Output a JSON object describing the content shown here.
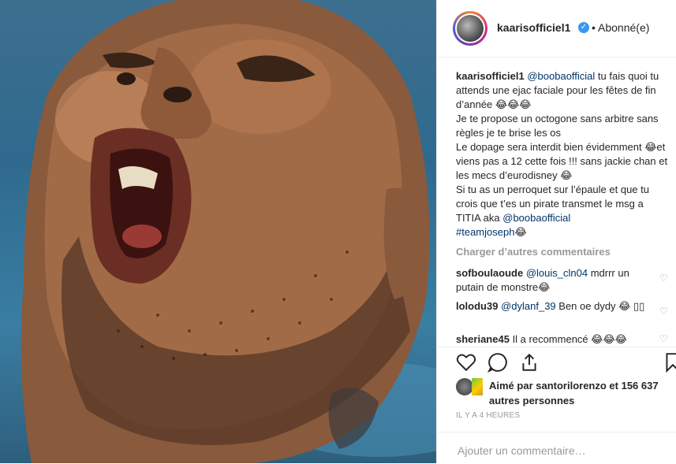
{
  "header": {
    "username": "kaarisofficiel1",
    "verified_glyph": "✓",
    "follow_status": "• Abonné(e)"
  },
  "caption": {
    "username": "kaarisofficiel1",
    "mention1": "@boobaofficial",
    "line1": " tu fais quoi tu attends une ejac faciale pour les fêtes de fin d’année 😂😂😂",
    "line2": "Je te propose un octogone sans arbitre sans règles je te brise les os",
    "line3": "Le dopage sera interdit bien évidemment 😂et viens pas a 12 cette fois !!! sans jackie chan et les mecs d’eurodisney 😂",
    "line4": "Si tu as un perroquet sur l’épaule et que tu crois que t’es un pirate transmet le msg a TITIA aka ",
    "mention2": "@boobaofficial",
    "hashtag": "#teamjoseph",
    "hashtag_emoji": "😂"
  },
  "load_more_label": "Charger d’autres commentaires",
  "comments": [
    {
      "user": "sofboulaoude",
      "mention": "@louis_cln04",
      "text": " mdrrr un putain de monstre😂"
    },
    {
      "user": "lolodu39",
      "mention": "@dylanf_39",
      "text": " Ben oe dydy 😂 ▯▯"
    },
    {
      "user": "sheriane45",
      "mention": "",
      "text": " Il a recommencé 😂😂😂"
    }
  ],
  "icons": {
    "like": "heart-icon",
    "comment": "comment-icon",
    "share": "share-icon",
    "save": "bookmark-icon"
  },
  "likes": {
    "text": "Aimé par santorilorenzo et 156 637 autres personnes"
  },
  "timestamp": "IL Y A 4 HEURES",
  "add_comment": {
    "placeholder": "Ajouter un commentaire…"
  },
  "colors": {
    "mention": "#003569",
    "verified": "#3897f0",
    "muted": "#999999"
  }
}
